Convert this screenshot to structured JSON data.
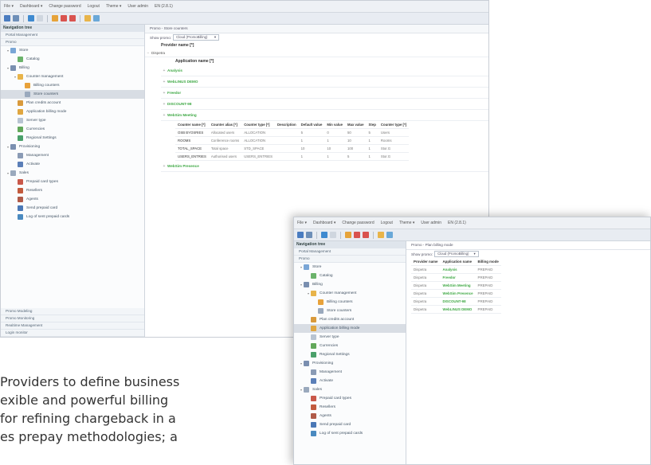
{
  "win1": {
    "menu": [
      "File ▾",
      "Dashboard ▾",
      "Change password",
      "Logout",
      "Theme ▾",
      "User admin",
      "EN (2.8.1)"
    ],
    "nav_title": "Navigation tree",
    "sections_top": [
      "Portal Management",
      "Promo"
    ],
    "tree": [
      {
        "label": "Store",
        "indent": 0,
        "twisty": "▾",
        "icon": "#7aa6d6"
      },
      {
        "label": "Catalog",
        "indent": 1,
        "twisty": "",
        "icon": "#6bb36b"
      },
      {
        "label": "Billing",
        "indent": 0,
        "twisty": "▾",
        "icon": "#7a8fb0"
      },
      {
        "label": "Counter management",
        "indent": 1,
        "twisty": "▾",
        "icon": "#e8b44a"
      },
      {
        "label": "Billing counters",
        "indent": 2,
        "twisty": "",
        "icon": "#e8a23a"
      },
      {
        "label": "Store counters",
        "indent": 2,
        "twisty": "",
        "icon": "#9aa9bd",
        "selected": true
      },
      {
        "label": "Plan credits account",
        "indent": 1,
        "twisty": "",
        "icon": "#d99a3c"
      },
      {
        "label": "Application billing mode",
        "indent": 1,
        "twisty": "",
        "icon": "#e0a640"
      },
      {
        "label": "Server type",
        "indent": 1,
        "twisty": "",
        "icon": "#b8c4d2"
      },
      {
        "label": "Currencies",
        "indent": 1,
        "twisty": "",
        "icon": "#62a85a"
      },
      {
        "label": "Regional Settings",
        "indent": 1,
        "twisty": "",
        "icon": "#4aa06a"
      },
      {
        "label": "Provisioning",
        "indent": 0,
        "twisty": "▾",
        "icon": "#7a8fb0"
      },
      {
        "label": "Management",
        "indent": 1,
        "twisty": "",
        "icon": "#8a9bb5"
      },
      {
        "label": "Activate",
        "indent": 1,
        "twisty": "",
        "icon": "#5b7fb8"
      },
      {
        "label": "Sales",
        "indent": 0,
        "twisty": "▾",
        "icon": "#9aa9bd"
      },
      {
        "label": "Prepaid card types",
        "indent": 1,
        "twisty": "",
        "icon": "#c9584a"
      },
      {
        "label": "Resellers",
        "indent": 1,
        "twisty": "",
        "icon": "#c25a3d"
      },
      {
        "label": "Agents",
        "indent": 1,
        "twisty": "",
        "icon": "#b05a48"
      },
      {
        "label": "Send prepaid card",
        "indent": 1,
        "twisty": "",
        "icon": "#4a78b6"
      },
      {
        "label": "Log of sent prepaid cards",
        "indent": 1,
        "twisty": "",
        "icon": "#4a8ac0"
      }
    ],
    "sections_bottom": [
      "Promo Modeling",
      "Promo Monitoring",
      "Realtime Management",
      "Login monitor"
    ],
    "breadcrumb": "Promo - Store counters",
    "filter_label": "Show promo:",
    "filter_value": "Cloud (PromoBilling)",
    "provider_header": "Provider name [*]",
    "provider": "Dispetra",
    "app_header": "Application name [*]",
    "apps": [
      "Analysis",
      "WebLINUS DEMO",
      "Freedor",
      "DISCOUNT-98",
      "WebSim Meeting"
    ],
    "apps_after": [
      "WebSim Presence"
    ],
    "counter_headers": [
      "Counter name [*]",
      "Counter alias [*]",
      "Counter type [*]",
      "Description",
      "Default value",
      "Min value",
      "Max value",
      "Step",
      "Counter type [*]"
    ],
    "counter_rows": [
      [
        "OSB BYOSRIES",
        "Allocated users",
        "ALLOCATION",
        "",
        "5",
        "0",
        "50",
        "5",
        "Users"
      ],
      [
        "ROOMS",
        "Conference rooms",
        "ALLOCATION",
        "",
        "1",
        "1",
        "10",
        "1",
        "Rooms"
      ],
      [
        "TOTAL_SPACE",
        "Total space",
        "STD_SPACE",
        "",
        "10",
        "10",
        "100",
        "1",
        "Stor.G"
      ],
      [
        "USERS_ENTRIES",
        "Authorised users",
        "USERS_ENTRIES",
        "",
        "1",
        "1",
        "5",
        "1",
        "Stor.G"
      ]
    ]
  },
  "win2": {
    "menu": [
      "File ▾",
      "Dashboard ▾",
      "Change password",
      "Logout",
      "Theme ▾",
      "User admin",
      "EN (2.8.1)"
    ],
    "nav_title": "Navigation tree",
    "sections_top": [
      "Portal Management",
      "Promo"
    ],
    "tree": [
      {
        "label": "Store",
        "indent": 0,
        "twisty": "▾",
        "icon": "#7aa6d6"
      },
      {
        "label": "Catalog",
        "indent": 1,
        "twisty": "",
        "icon": "#6bb36b"
      },
      {
        "label": "Billing",
        "indent": 0,
        "twisty": "▾",
        "icon": "#7a8fb0"
      },
      {
        "label": "Counter management",
        "indent": 1,
        "twisty": "▾",
        "icon": "#e8b44a"
      },
      {
        "label": "Billing counters",
        "indent": 2,
        "twisty": "",
        "icon": "#e8a23a"
      },
      {
        "label": "Store counters",
        "indent": 2,
        "twisty": "",
        "icon": "#9aa9bd"
      },
      {
        "label": "Plan credits account",
        "indent": 1,
        "twisty": "",
        "icon": "#d99a3c"
      },
      {
        "label": "Application billing mode",
        "indent": 1,
        "twisty": "",
        "icon": "#e0a640",
        "selected": true
      },
      {
        "label": "Server type",
        "indent": 1,
        "twisty": "",
        "icon": "#b8c4d2"
      },
      {
        "label": "Currencies",
        "indent": 1,
        "twisty": "",
        "icon": "#62a85a"
      },
      {
        "label": "Regional Settings",
        "indent": 1,
        "twisty": "",
        "icon": "#4aa06a"
      },
      {
        "label": "Provisioning",
        "indent": 0,
        "twisty": "▾",
        "icon": "#7a8fb0"
      },
      {
        "label": "Management",
        "indent": 1,
        "twisty": "",
        "icon": "#8a9bb5"
      },
      {
        "label": "Activate",
        "indent": 1,
        "twisty": "",
        "icon": "#5b7fb8"
      },
      {
        "label": "Sales",
        "indent": 0,
        "twisty": "▾",
        "icon": "#9aa9bd"
      },
      {
        "label": "Prepaid card types",
        "indent": 1,
        "twisty": "",
        "icon": "#c9584a"
      },
      {
        "label": "Resellers",
        "indent": 1,
        "twisty": "",
        "icon": "#c25a3d"
      },
      {
        "label": "Agents",
        "indent": 1,
        "twisty": "",
        "icon": "#b05a48"
      },
      {
        "label": "Send prepaid card",
        "indent": 1,
        "twisty": "",
        "icon": "#4a78b6"
      },
      {
        "label": "Log of sent prepaid cards",
        "indent": 1,
        "twisty": "",
        "icon": "#4a8ac0"
      }
    ],
    "breadcrumb": "Promo - Plan billing mode",
    "filter_label": "Show promo:",
    "filter_value": "Cloud (PromoBilling)",
    "headers": [
      "Provider name",
      "Application name",
      "Billing mode"
    ],
    "rows": [
      [
        "Dispetra",
        "Analysis",
        "PREPAID"
      ],
      [
        "Dispetra",
        "Freedor",
        "PREPAID"
      ],
      [
        "Dispetra",
        "WebSim Meeting",
        "PREPAID"
      ],
      [
        "Dispetra",
        "WebSim Presence",
        "PREPAID"
      ],
      [
        "Dispetra",
        "DISCOUNT-98",
        "PREPAID"
      ],
      [
        "Dispetra",
        "WebLINUS DEMO",
        "PREPAID"
      ]
    ]
  },
  "body_text": [
    "Providers to define business",
    "exible and powerful billing",
    "for refining chargeback in a",
    "es prepay methodologies; a"
  ],
  "colors": {
    "accent_green": "#3ea844",
    "selection": "#d8dde4"
  }
}
